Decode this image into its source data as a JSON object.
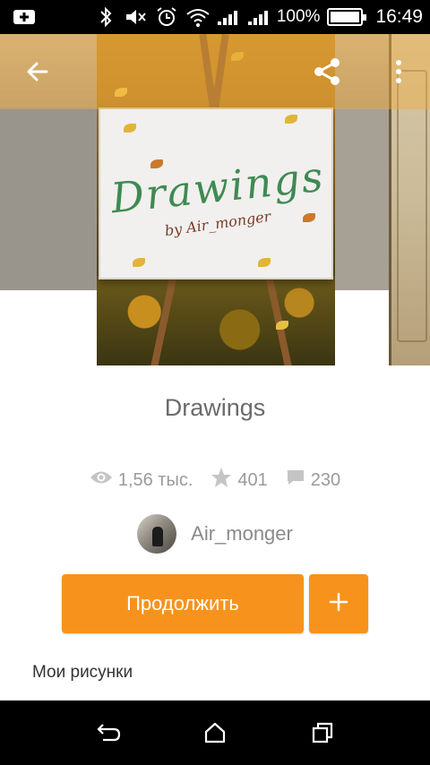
{
  "status_bar": {
    "battery_percent": "100%",
    "time": "16:49",
    "battery_level": 1.0,
    "icons": [
      "download-icon",
      "bluetooth-icon",
      "mute-icon",
      "alarm-icon",
      "wifi-icon",
      "signal-1-icon",
      "signal-2-icon",
      "battery-icon"
    ]
  },
  "top_bar": {
    "icons": [
      "back-arrow-icon",
      "share-icon",
      "more-vert-icon"
    ]
  },
  "book": {
    "title": "Drawings",
    "cover_text": {
      "title": "Drawings",
      "subtitle": "by Air_monger"
    },
    "stats": {
      "views": "1,56 тыс.",
      "votes": "401",
      "comments": "230"
    },
    "author": {
      "name": "Air_monger"
    }
  },
  "actions": {
    "continue_label": "Продолжить",
    "add_label": "+"
  },
  "section": {
    "label": "Мои рисунки"
  },
  "nav_bar": {
    "icons": [
      "back-nav-icon",
      "home-nav-icon",
      "recents-nav-icon"
    ]
  },
  "colors": {
    "accent": "#f7931d",
    "status_bar": "#000000",
    "text_secondary": "#9a9a9a"
  }
}
